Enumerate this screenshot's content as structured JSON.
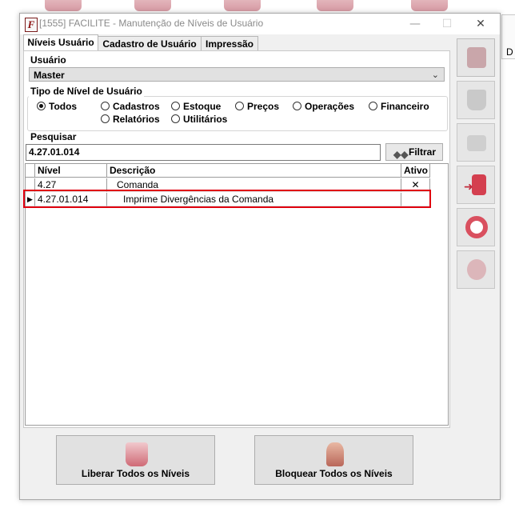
{
  "window": {
    "title": "[1555] FACILITE - Manutenção de Níveis de Usuário",
    "app_icon_letter": "F",
    "minimize": "—",
    "maximize": "☐",
    "close": "✕"
  },
  "tabs": [
    {
      "label": "Níveis Usuário",
      "active": true
    },
    {
      "label": "Cadastro de Usuário",
      "active": false
    },
    {
      "label": "Impressão",
      "active": false
    }
  ],
  "usuario": {
    "label": "Usuário",
    "value": "Master"
  },
  "tipo_nivel": {
    "label": "Tipo de Nível de Usuário",
    "options": [
      {
        "label": "Todos",
        "selected": true
      },
      {
        "label": "Cadastros",
        "selected": false
      },
      {
        "label": "Estoque",
        "selected": false
      },
      {
        "label": "Preços",
        "selected": false
      },
      {
        "label": "Operações",
        "selected": false
      },
      {
        "label": "Financeiro",
        "selected": false
      },
      {
        "label": "Relatórios",
        "selected": false
      },
      {
        "label": "Utilitários",
        "selected": false
      }
    ]
  },
  "pesquisar": {
    "label": "Pesquisar",
    "value": "4.27.01.014",
    "button": "Filtrar"
  },
  "grid": {
    "columns": [
      "Nível",
      "Descrição",
      "Ativo"
    ],
    "rows": [
      {
        "nivel": "4.27",
        "descricao": "Comanda",
        "ativo": "✕"
      },
      {
        "nivel": "4.27.01.014",
        "descricao": "Imprime Divergências da Comanda",
        "ativo": ""
      }
    ],
    "current_row_marker": "▶"
  },
  "buttons": {
    "liberar": "Liberar Todos os Níveis",
    "bloquear": "Bloquear Todos os Níveis"
  },
  "sidebar_icons": [
    "save-icon",
    "trash-icon",
    "printer-icon",
    "exit-door-icon",
    "lifebuoy-icon",
    "settings-icon"
  ],
  "background": {
    "side_letter": "D"
  },
  "colors": {
    "accent": "#c7505f",
    "highlight": "#e0000f"
  }
}
